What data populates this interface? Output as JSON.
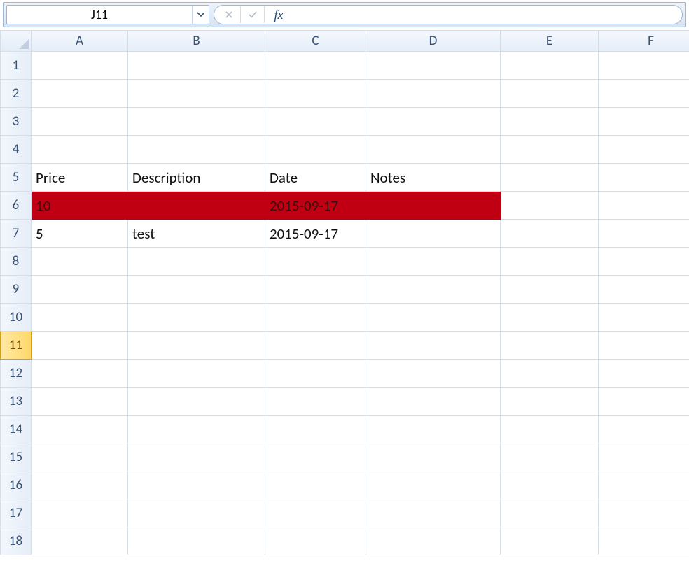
{
  "nameBox": {
    "value": "J11"
  },
  "formula": {
    "value": ""
  },
  "fxLabel": "fx",
  "columns": [
    "A",
    "B",
    "C",
    "D",
    "E",
    "F"
  ],
  "rowCount": 18,
  "activeRow": 11,
  "highlight": {
    "row": 6,
    "colStart": 1,
    "colEnd": 4,
    "color": "#c00012"
  },
  "cells": {
    "A5": "Price",
    "B5": "Description",
    "C5": "Date",
    "D5": "Notes",
    "A6": "10",
    "C6": "2015-09-17",
    "A7": "5",
    "B7": "test",
    "C7": "2015-09-17"
  }
}
